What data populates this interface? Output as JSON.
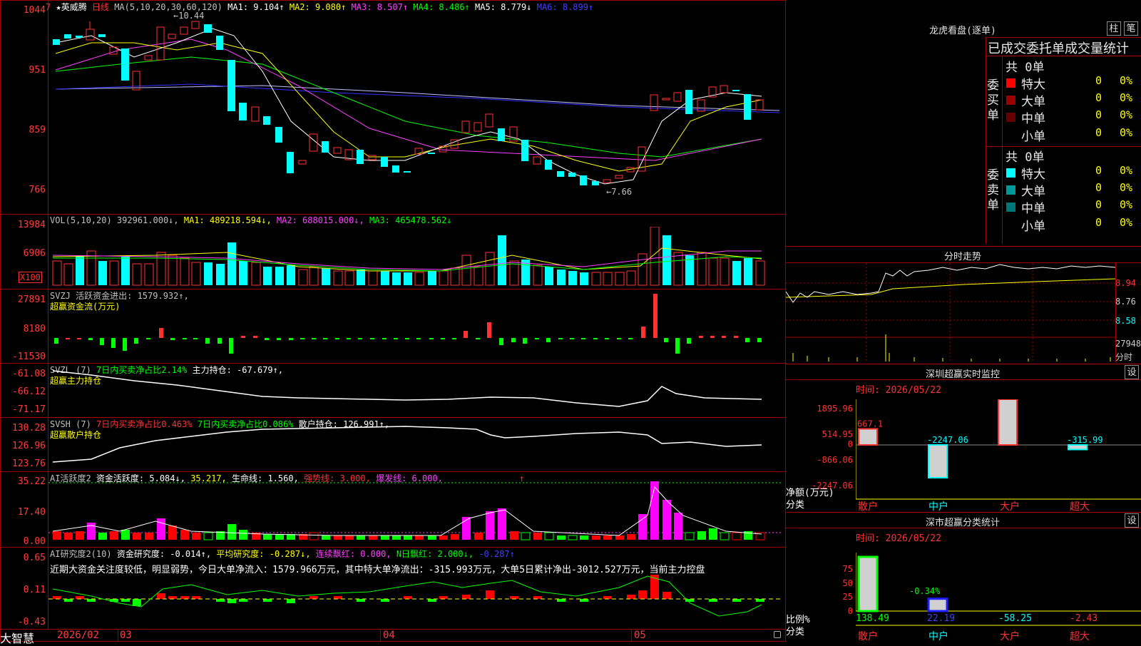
{
  "header": {
    "stock_name": "★英威腾",
    "period": "日线",
    "ma_label": "MA(5,10,20,30,60,120)",
    "ma1": "MA1: 9.104↑",
    "ma2": "MA2: 9.080↑",
    "ma3": "MA3: 8.507↑",
    "ma4": "MA4: 8.486↑",
    "ma5": "MA5: 8.779↓",
    "ma6": "MA6: 8.899↑",
    "high_marker": "10.44",
    "low_marker": "7.66",
    "price_y": [
      "1044",
      "951",
      "859",
      "766"
    ],
    "price_y_top": "7"
  },
  "vol": {
    "title": "VOL(5,10,20) 392961.000↓,",
    "ma1": "MA1: 489218.594↓,",
    "ma2": "MA2: 688015.000↓,",
    "ma3": "MA3: 465478.562↓",
    "y": [
      "13984",
      "6906",
      "X100"
    ]
  },
  "svzj": {
    "title": "SVZJ  活跃资金进出: 1579.932↑,",
    "subtitle": "超赢资金流(万元)",
    "y": [
      "27891",
      "8180",
      "-11530"
    ]
  },
  "svzl": {
    "title_a": "SVZL (7)",
    "title_b": "7日内买卖净占比2.14%",
    "title_c": "主力持仓: -67.679↑,",
    "subtitle": "超赢主力持仓",
    "y": [
      "-61.08",
      "-66.12",
      "-71.17"
    ]
  },
  "svsh": {
    "title_a": "SVSH (7)",
    "title_b": "7日内买卖净占比0.463%",
    "title_c": "7日内买卖净占比0.086%",
    "title_d": "散户持仓: 126.991↑,",
    "subtitle": "超赢散户持仓",
    "y": [
      "130.28",
      "126.96",
      "123.76"
    ]
  },
  "ai1": {
    "title_a": "AI活跃度2",
    "title_b": "资金活跃度: 5.084↓,",
    "title_c": "35.217,",
    "title_d": "生命线: 1.560,",
    "title_e": "强势线: 3.000,",
    "title_f": "爆发线: 6.000,",
    "arrow": "↑",
    "y": [
      "35.22",
      "17.40",
      "0.00"
    ]
  },
  "ai2": {
    "title_a": "AI研究度2(10)",
    "title_b": "资金研究度: -0.014↑,",
    "title_c": "平均研究度: -0.287↓,",
    "title_d": "连续飘红: 0.000,",
    "title_e": "N日飘红: 2.000↓,",
    "title_f": "-0.287↑",
    "comment": "近期大资金关注度较低，明显弱势，今日大单净流入：1579.966万元，其中特大单净流出：-315.993万元，大单5日累计净出-3012.527万元，当前主力控盘",
    "y": [
      "0.65",
      "0.11",
      "-0.43"
    ]
  },
  "xaxis": {
    "brand": "大智慧",
    "labels": [
      "2026/02",
      "03",
      "04",
      "05"
    ]
  },
  "right": {
    "lhb_title": "龙虎看盘(逐单)",
    "btn_bar": "柱",
    "btn_pen": "笔",
    "stats_title": "已成交委托单成交量统计",
    "buy_label": "委买单",
    "sell_label": "委卖单",
    "buy_total": "共 0单",
    "sell_total": "共 0单",
    "buy_rows": [
      {
        "name": "特大",
        "count": "0",
        "pct": "0%",
        "color": "#ff0000"
      },
      {
        "name": "大单",
        "count": "0",
        "pct": "0%",
        "color": "#990000"
      },
      {
        "name": "中单",
        "count": "0",
        "pct": "0%",
        "color": "#660000"
      },
      {
        "name": "小单",
        "count": "0",
        "pct": "0%",
        "color": "#000000"
      }
    ],
    "sell_rows": [
      {
        "name": "特大",
        "count": "0",
        "pct": "0%",
        "color": "#00ffff"
      },
      {
        "name": "大单",
        "count": "0",
        "pct": "0%",
        "color": "#009999"
      },
      {
        "name": "中单",
        "count": "0",
        "pct": "0%",
        "color": "#007777"
      },
      {
        "name": "小单",
        "count": "0",
        "pct": "0%",
        "color": "#000000"
      }
    ],
    "intraday_title": "分时走势",
    "intraday_y": [
      "8.94",
      "8.76",
      "8.58"
    ],
    "intraday_vol": "27948",
    "intraday_vol_label": "分时",
    "sz_title": "深圳超赢实时监控",
    "sz_btn": "设",
    "sz_time": "时间: 2026/05/22",
    "sz_y": [
      "1895.96",
      "514.95",
      "0",
      "-866.06",
      "-2247.06"
    ],
    "sz_values": [
      {
        "label": "667.1",
        "value": 667.1
      },
      {
        "label": "-2247.06",
        "value": -2247.06
      },
      {
        "label": "1895.96",
        "value": 1895.96
      },
      {
        "label": "-315.99",
        "value": -315.99
      }
    ],
    "sz_ylab1": "净额(万元)",
    "sz_ylab2": "分类",
    "sz_cats": [
      "散户",
      "中户",
      "大户",
      "超大"
    ],
    "sm_title": "深市超赢分类统计",
    "sm_btn": "设",
    "sm_time": "时间: 2026/05/22",
    "sm_y": [
      "75",
      "50",
      "25",
      "0"
    ],
    "sm_ylab1": "比例%",
    "sm_ylab2": "分类",
    "sm_bar_label": "-0.34%",
    "sm_values": [
      "138.49",
      "22.19",
      "-58.25",
      "-2.43"
    ],
    "sm_cats": [
      "散户",
      "中户",
      "大户",
      "超大"
    ]
  },
  "chart_data": [
    {
      "type": "bar",
      "title": "深圳超赢实时监控",
      "categories": [
        "散户",
        "中户",
        "大户",
        "超大"
      ],
      "values": [
        667.1,
        -2247.06,
        1895.96,
        -315.99
      ],
      "ylabel": "净额(万元)",
      "ylim": [
        -2247.06,
        1895.96
      ]
    },
    {
      "type": "bar",
      "title": "深市超赢分类统计",
      "categories": [
        "散户",
        "中户",
        "大户",
        "超大"
      ],
      "values": [
        138.49,
        22.19,
        -58.25,
        -2.43
      ],
      "ylabel": "比例%",
      "ylim": [
        0,
        75
      ]
    }
  ]
}
